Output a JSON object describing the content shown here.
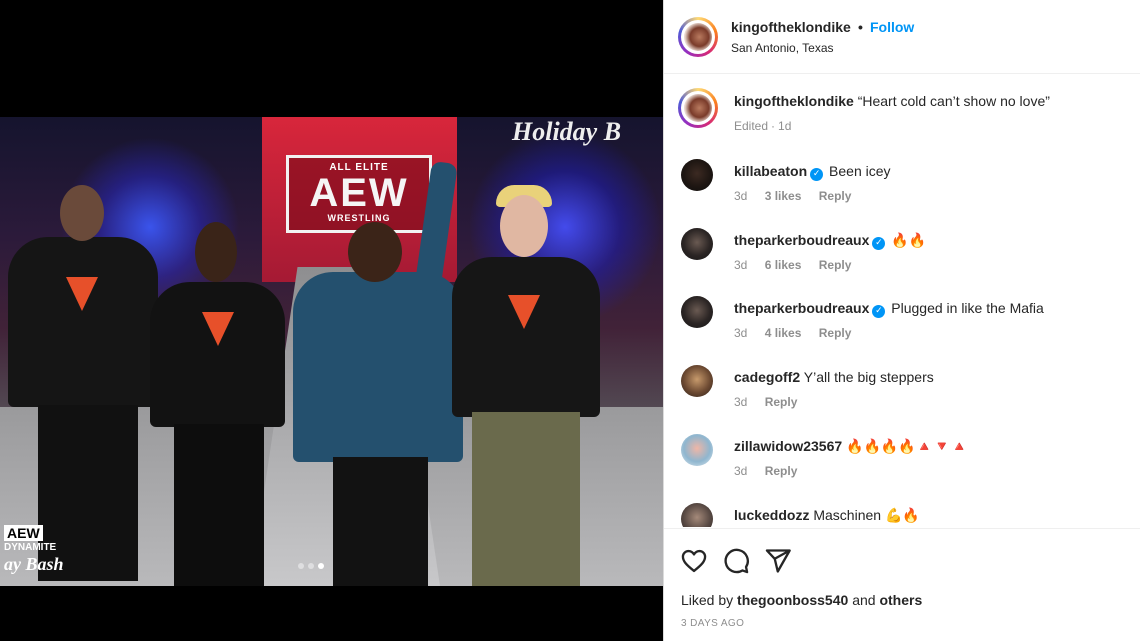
{
  "post": {
    "author": "kingoftheklondike",
    "bullet": "•",
    "follow_label": "Follow",
    "location": "San Antonio, Texas",
    "carousel": {
      "slide_count": 3,
      "active_index": 2
    },
    "photo": {
      "banner_text": "Holiday B",
      "logo_small": "ALL ELITE",
      "logo_main": "AEW",
      "logo_sub": "WRESTLING",
      "corner_logo_main": "AEW",
      "corner_logo_sub": "DYNAMITE",
      "corner_logo_script": "ay Bash"
    }
  },
  "caption": {
    "user": "kingoftheklondike",
    "text": "“Heart cold can’t show no love”",
    "meta_edited": "Edited",
    "meta_sep": "·",
    "meta_time": "1d"
  },
  "comments": [
    {
      "user": "killabeaton",
      "verified": true,
      "text": "Been icey",
      "time": "3d",
      "likes": "3 likes",
      "reply": "Reply",
      "avatar": "av-killa"
    },
    {
      "user": "theparkerboudreaux",
      "verified": true,
      "text": "🔥🔥",
      "time": "3d",
      "likes": "6 likes",
      "reply": "Reply",
      "avatar": "av-parker"
    },
    {
      "user": "theparkerboudreaux",
      "verified": true,
      "text": "Plugged in like the Mafia",
      "time": "3d",
      "likes": "4 likes",
      "reply": "Reply",
      "avatar": "av-parker"
    },
    {
      "user": "cadegoff2",
      "verified": false,
      "text": "Y’all the big steppers",
      "time": "3d",
      "likes": "",
      "reply": "Reply",
      "avatar": "av-cade"
    },
    {
      "user": "zillawidow23567",
      "verified": false,
      "text": "🔥🔥🔥🔥🔺🔻🔺",
      "time": "3d",
      "likes": "",
      "reply": "Reply",
      "avatar": "av-zilla"
    },
    {
      "user": "luckeddozz",
      "verified": false,
      "text": "Maschinen 💪🔥",
      "time": "",
      "likes": "",
      "reply": "",
      "avatar": "av-lucked"
    }
  ],
  "actions": {
    "like_icon": "heart-icon",
    "comment_icon": "comment-icon",
    "share_icon": "share-icon"
  },
  "likes_line": {
    "prefix": "Liked by",
    "user": "thegoonboss540",
    "and": "and",
    "others": "others"
  },
  "date": "3 DAYS AGO",
  "colors": {
    "link_blue": "#0095f6",
    "verified_blue": "#0095f6",
    "text": "#262626",
    "muted": "#8e8e8e"
  }
}
